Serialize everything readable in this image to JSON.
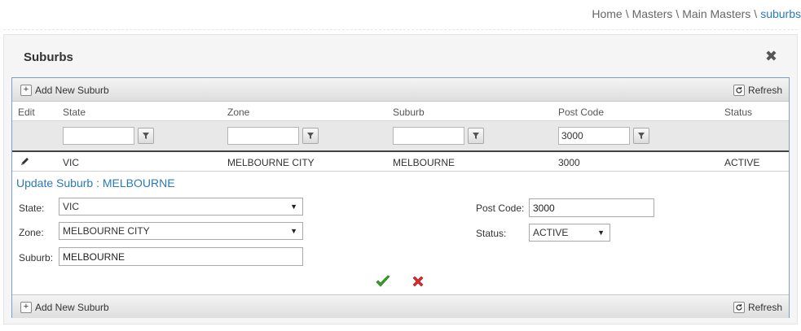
{
  "breadcrumb": {
    "items": [
      "Home",
      "Masters",
      "Main Masters"
    ],
    "separator": "\\",
    "current": "suburbs"
  },
  "panel": {
    "title": "Suburbs",
    "close_glyph": "✖"
  },
  "toolbar": {
    "add_label": "Add New Suburb",
    "refresh_label": "Refresh",
    "add_icon": "plus-icon",
    "refresh_icon": "refresh-icon"
  },
  "grid": {
    "columns": [
      "Edit",
      "State",
      "Zone",
      "Suburb",
      "Post Code",
      "Status"
    ],
    "filters": {
      "state": "",
      "zone": "",
      "suburb": "",
      "post_code": "3000"
    },
    "rows": [
      {
        "state": "VIC",
        "zone": "MELBOURNE CITY",
        "suburb": "MELBOURNE",
        "post_code": "3000",
        "status": "ACTIVE"
      }
    ]
  },
  "edit_form": {
    "title": "Update Suburb : MELBOURNE",
    "state_label": "State:",
    "state_value": "VIC",
    "zone_label": "Zone:",
    "zone_value": "MELBOURNE CITY",
    "suburb_label": "Suburb:",
    "suburb_value": "MELBOURNE",
    "post_code_label": "Post Code:",
    "post_code_value": "3000",
    "status_label": "Status:",
    "status_value": "ACTIVE"
  },
  "colors": {
    "accent": "#2a7ab8",
    "grid_border": "#7d9ccf",
    "save_green": "#3aa12c",
    "cancel_red": "#d92b2b"
  }
}
